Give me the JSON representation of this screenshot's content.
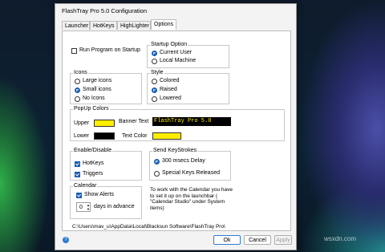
{
  "window": {
    "title": "FlashTray Pro 5.0 Configuration"
  },
  "tabs": [
    "Launcher",
    "HotKeys",
    "HighLighter",
    "Options"
  ],
  "run_on_startup": {
    "label": "Run Program on Startup",
    "checked": false
  },
  "startup_option": {
    "title": "Startup Option",
    "items": [
      "Current User",
      "Local Machine"
    ],
    "selected": "Current User"
  },
  "icons": {
    "title": "Icons",
    "items": [
      "Large icons",
      "Small icons",
      "No Icons"
    ],
    "selected": "Small icons"
  },
  "style": {
    "title": "Style",
    "items": [
      "Colored",
      "Raised",
      "Lowered"
    ],
    "selected": "Raised"
  },
  "popup_colors": {
    "title": "PopUp Colors",
    "upper_label": "Upper",
    "lower_label": "Lower",
    "banner_text_label": "Banner Text",
    "banner_text_value": "FlashTray Pro 5.0",
    "text_color_label": "Text Color",
    "upper_color": "#ffee00",
    "lower_color": "#000000",
    "text_color": "#ffee00"
  },
  "enable_disable": {
    "title": "Enable/Disable",
    "hotkeys": "HotKeys",
    "triggers": "Triggers"
  },
  "send_keystrokes": {
    "title": "Send KeyStrokes",
    "items": [
      "300 msecs Delay",
      "Special Keys Released"
    ],
    "selected": "300 msecs Delay"
  },
  "calendar": {
    "title": "Calendar",
    "show_alerts": "Show Alerts",
    "days_value": "0",
    "days_label": "days in advance",
    "note": "To work with the Calendar you have to set it up on the launchbar ( \"Calendar Studio\" under System items)"
  },
  "path": "C:\\Users\\mav_u\\AppData\\Local\\Blacksun Software\\FlashTray Pro\\",
  "buttons": {
    "ok": "Ok",
    "cancel": "Cancel",
    "apply": "Apply"
  }
}
